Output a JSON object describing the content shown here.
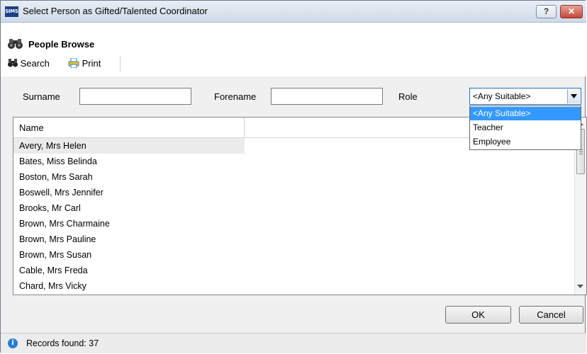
{
  "window": {
    "title": "Select Person as Gifted/Talented Coordinator",
    "app_icon_text": "SIMS",
    "help_button": "?",
    "close_button": "✕"
  },
  "header": {
    "title": "People Browse",
    "icon": "binoculars-icon"
  },
  "toolbar": {
    "search_label": "Search",
    "search_icon": "binoculars-small-icon",
    "print_label": "Print",
    "print_icon": "printer-icon"
  },
  "filters": {
    "surname_label": "Surname",
    "surname_value": "",
    "forename_label": "Forename",
    "forename_value": "",
    "role_label": "Role",
    "role_value": "<Any Suitable>",
    "role_options": [
      "<Any Suitable>",
      "Teacher",
      "Employee"
    ]
  },
  "grid": {
    "columns": [
      "Name"
    ],
    "rows": [
      "Avery, Mrs Helen",
      "Bates, Miss Belinda",
      "Boston, Mrs Sarah",
      "Boswell, Mrs Jennifer",
      "Brooks, Mr Carl",
      "Brown, Mrs Charmaine",
      "Brown, Mrs Pauline",
      "Brown, Mrs Susan",
      "Cable, Mrs Freda",
      "Chard, Mrs Vicky"
    ],
    "selected_row": 0
  },
  "buttons": {
    "ok": "OK",
    "cancel": "Cancel"
  },
  "status": {
    "text": "Records found: 37"
  },
  "colors": {
    "dropdown_highlight": "#3399ff",
    "title_close": "#c3463a"
  }
}
